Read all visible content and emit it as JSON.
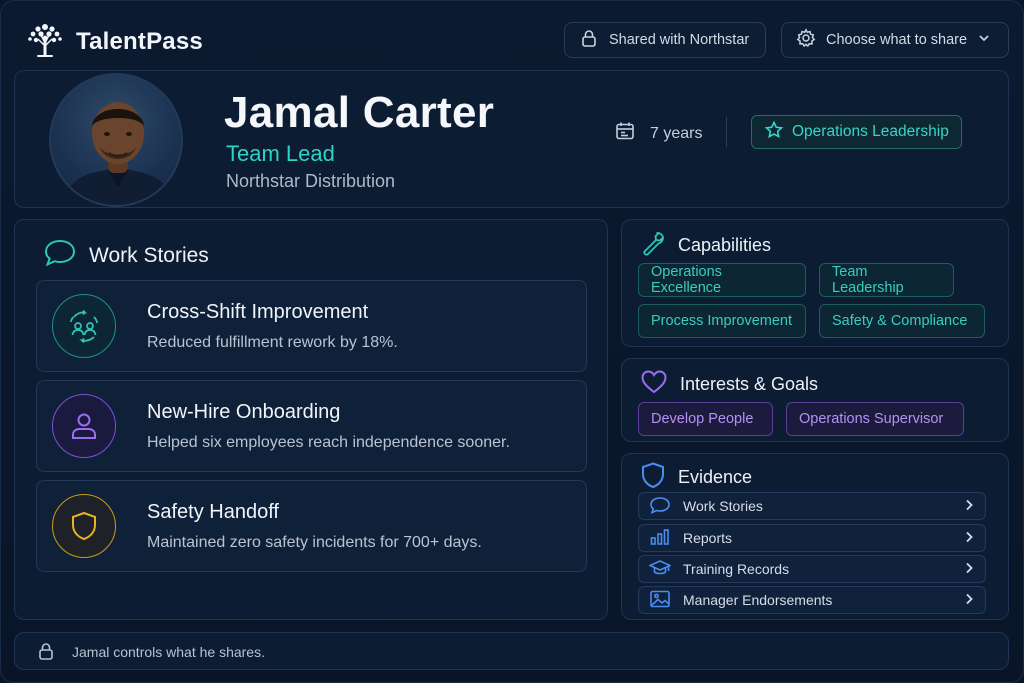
{
  "app": {
    "name": "TalentPass"
  },
  "header": {
    "shared_label": "Shared with Northstar",
    "choose_label": "Choose what to share"
  },
  "profile": {
    "name": "Jamal Carter",
    "role": "Team Lead",
    "org": "Northstar Distribution",
    "years": "7 years",
    "badge": "Operations Leadership"
  },
  "work_stories": {
    "title": "Work Stories",
    "items": [
      {
        "title": "Cross-Shift Improvement",
        "desc": "Reduced fulfillment rework by 18%.",
        "icon": "people-cycle-icon",
        "color": "#2ec4b6"
      },
      {
        "title": "New-Hire Onboarding",
        "desc": "Helped six employees reach independence sooner.",
        "icon": "person-icon",
        "color": "#9b6cf0"
      },
      {
        "title": "Safety Handoff",
        "desc": "Maintained zero safety incidents for 700+ days.",
        "icon": "shield-icon",
        "color": "#e6b21f"
      }
    ]
  },
  "capabilities": {
    "title": "Capabilities",
    "chips": [
      "Operations Excellence",
      "Team Leadership",
      "Process Improvement",
      "Safety & Compliance"
    ]
  },
  "interests": {
    "title": "Interests & Goals",
    "chips": [
      "Develop People",
      "Operations Supervisor"
    ]
  },
  "evidence": {
    "title": "Evidence",
    "items": [
      {
        "label": "Work Stories",
        "icon": "chat-bubble-icon"
      },
      {
        "label": "Reports",
        "icon": "bar-chart-icon"
      },
      {
        "label": "Training Records",
        "icon": "graduation-cap-icon"
      },
      {
        "label": "Manager Endorsements",
        "icon": "image-icon"
      }
    ]
  },
  "footer": {
    "text": "Jamal controls what he shares."
  },
  "colors": {
    "teal": "#2ed3c4",
    "purple": "#b491f2",
    "gold": "#e6b21f",
    "blue": "#4a8cf0"
  }
}
